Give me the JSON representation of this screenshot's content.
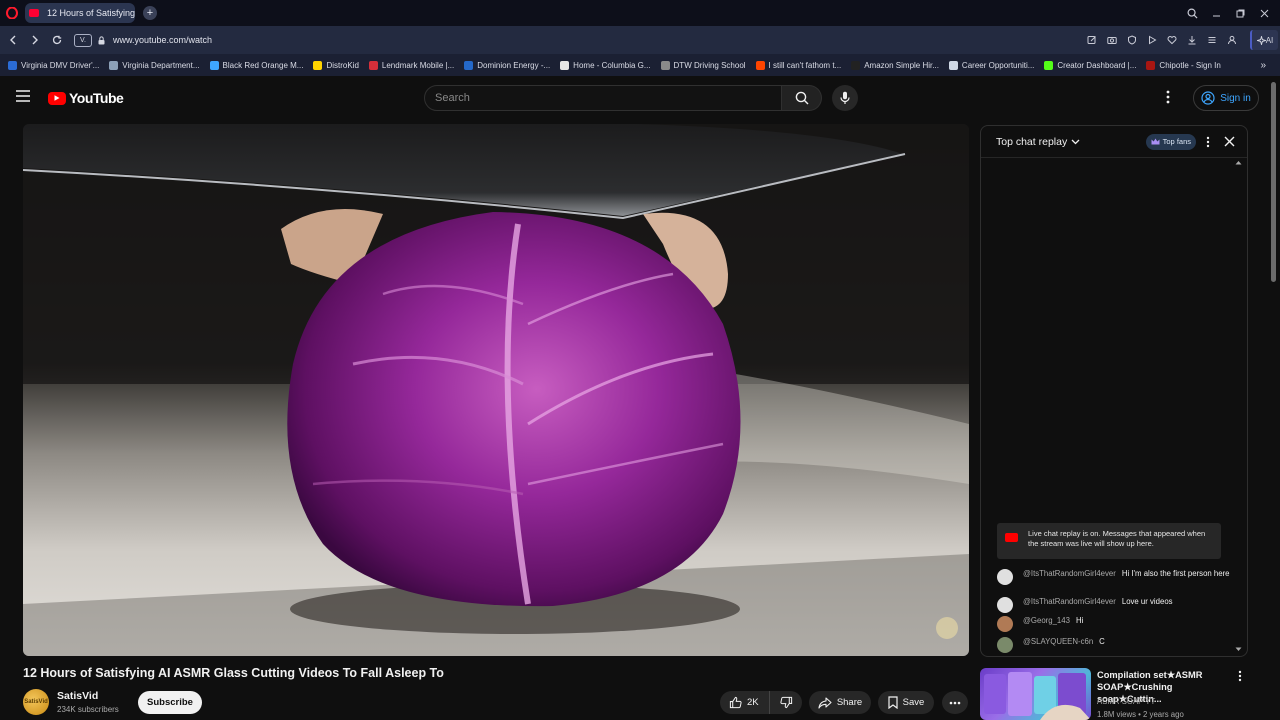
{
  "browser": {
    "tab_title": "12 Hours of Satisfying",
    "url": "www.youtube.com/watch",
    "vpn_label": "V.",
    "ai_label": "AI",
    "bookmarks": [
      {
        "label": "Virginia DMV Driver'...",
        "color": "#2b6cd6"
      },
      {
        "label": "Virginia Department...",
        "color": "#8ca0b8"
      },
      {
        "label": "Black Red Orange M...",
        "color": "#3ea6ff"
      },
      {
        "label": "DistroKid",
        "color": "#ffd400"
      },
      {
        "label": "Lendmark Mobile |...",
        "color": "#d62f3a"
      },
      {
        "label": "Dominion Energy -...",
        "color": "#2468c9"
      },
      {
        "label": "Home - Columbia G...",
        "color": "#e6e6e6"
      },
      {
        "label": "DTW Driving School",
        "color": "#8a8a8a"
      },
      {
        "label": "I still can't fathom t...",
        "color": "#ff4500"
      },
      {
        "label": "Amazon Simple Hir...",
        "color": "#222222"
      },
      {
        "label": "Career Opportuniti...",
        "color": "#cfd8e6"
      },
      {
        "label": "Creator Dashboard |...",
        "color": "#53fc18"
      },
      {
        "label": "Chipotle - Sign In",
        "color": "#a81612"
      }
    ]
  },
  "youtube": {
    "logo_text": "YouTube",
    "search_placeholder": "Search",
    "sign_in": "Sign in"
  },
  "video": {
    "title": "12 Hours of Satisfying AI ASMR Glass Cutting Videos To Fall Asleep To",
    "channel": "SatisVid",
    "subscribers": "234K subscribers",
    "avatar_text": "SatisVid",
    "subscribe": "Subscribe",
    "likes": "2K",
    "share": "Share",
    "save": "Save"
  },
  "chat": {
    "title": "Top chat replay",
    "top_fans": "Top fans",
    "replay_notice": "Live chat replay is on. Messages that appeared when the stream was live will show up here.",
    "messages": [
      {
        "author": "@ItsThatRandomGirl4ever",
        "text": "Hi I'm also the first person here",
        "avatar_color": "#e0e0e0"
      },
      {
        "author": "@ItsThatRandomGirl4ever",
        "text": "Love ur videos",
        "avatar_color": "#e0e0e0"
      },
      {
        "author": "@Georg_143",
        "text": "Hi",
        "avatar_color": "#b07a55"
      },
      {
        "author": "@SLAYQUEEN-c6n",
        "text": "C",
        "avatar_color": "#7a8a6a"
      }
    ]
  },
  "recommendation": {
    "title": "Compilation set★ASMR SOAP★Crushing soap★Cuttin...",
    "channel": "ASMR SOAP YT",
    "meta": "1.8M views • 2 years ago"
  },
  "colors": {
    "brand_red": "#ff0000",
    "link_blue": "#3ea6ff",
    "bg": "#0f0f0f"
  }
}
